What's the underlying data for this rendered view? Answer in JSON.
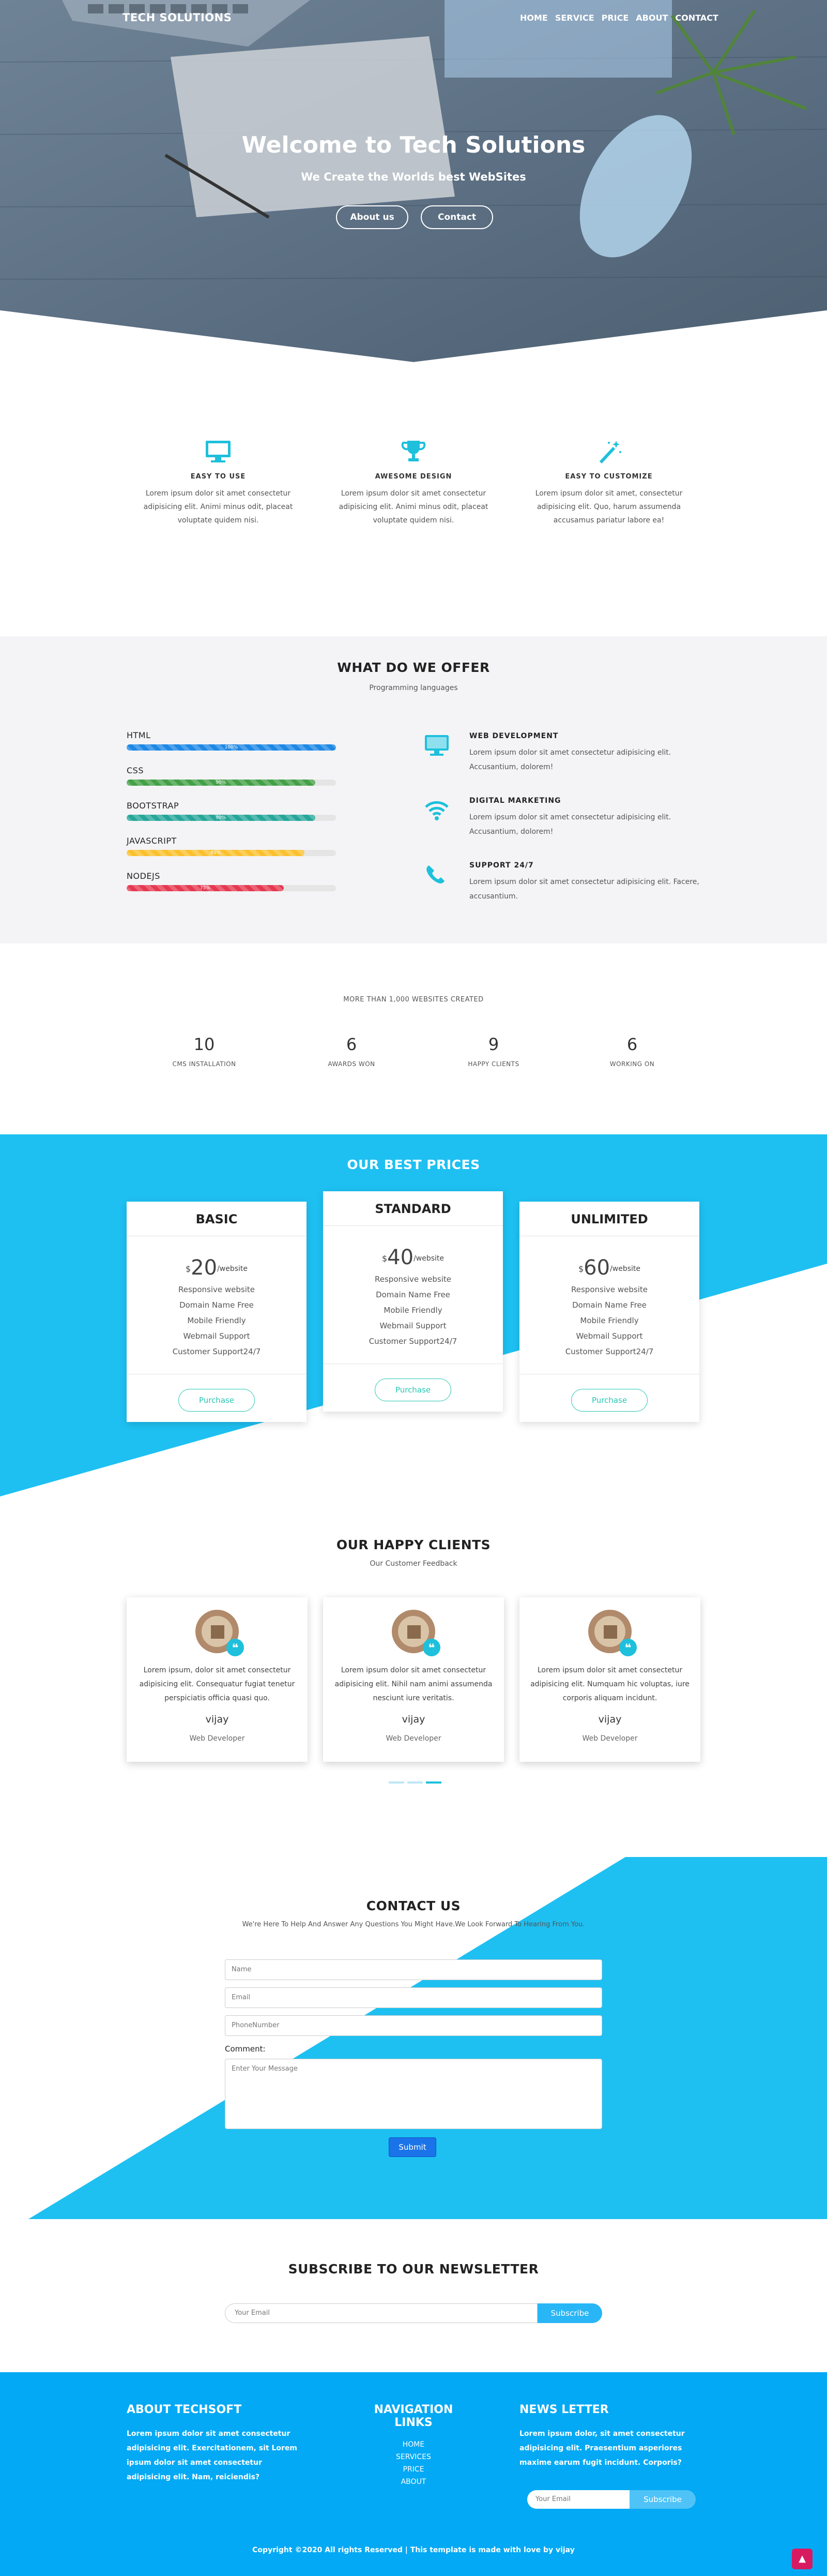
{
  "colors": {
    "accent": "#1ec0dc",
    "brand": "#03a9f4",
    "submit": "#1a73e8"
  },
  "nav": {
    "brand": "TECH SOLUTIONS",
    "links": [
      "HOME",
      "SERVICE",
      "PRICE",
      "ABOUT",
      "CONTACT"
    ]
  },
  "hero": {
    "title": "Welcome to Tech Solutions",
    "subtitle": "We Create the Worlds best WebSites",
    "btn_about": "About us",
    "btn_contact": "Contact"
  },
  "features": [
    {
      "icon": "monitor-icon",
      "title": "EASY TO USE",
      "text": "Lorem ipsum dolor sit amet consectetur adipisicing elit. Animi minus odit, placeat voluptate quidem nisi."
    },
    {
      "icon": "trophy-icon",
      "title": "AWESOME DESIGN",
      "text": "Lorem ipsum dolor sit amet consectetur adipisicing elit. Animi minus odit, placeat voluptate quidem nisi."
    },
    {
      "icon": "magic-wand-icon",
      "title": "EASY TO CUSTOMIZE",
      "text": "Lorem ipsum dolor sit amet, consectetur adipisicing elit. Quo, harum assumenda accusamus pariatur labore ea!"
    }
  ],
  "offer": {
    "title": "WHAT DO WE OFFER",
    "subtitle": "Programming languages",
    "skills": [
      {
        "name": "HTML",
        "percent": 100,
        "label": "100%",
        "color": "#1e88e5"
      },
      {
        "name": "CSS",
        "percent": 90,
        "label": "90%",
        "color": "#43a047"
      },
      {
        "name": "BOOTSTRAP",
        "percent": 90,
        "label": "90%",
        "color": "#26a69a"
      },
      {
        "name": "JAVASCRIPT",
        "percent": 85,
        "label": "85%",
        "color": "#fbc02d"
      },
      {
        "name": "NODEJS",
        "percent": 75,
        "label": "75%",
        "color": "#e53950"
      }
    ],
    "services": [
      {
        "icon": "desktop-icon",
        "title": "WEB DEVELOPMENT",
        "text": "Lorem ipsum dolor sit amet consectetur adipisicing elit. Accusantium, dolorem!"
      },
      {
        "icon": "wifi-icon",
        "title": "DIGITAL MARKETING",
        "text": "Lorem ipsum dolor sit amet consectetur adipisicing elit. Accusantium, dolorem!"
      },
      {
        "icon": "phone-icon",
        "title": "SUPPORT 24/7",
        "text": "Lorem ipsum dolor sit amet consectetur adipisicing elit. Facere, accusantium."
      }
    ]
  },
  "stats": {
    "caption": "MORE THAN 1,000 WEBSITES CREATED",
    "items": [
      {
        "num": "10",
        "label": "CMS INSTALLATION"
      },
      {
        "num": "6",
        "label": "AWARDS WON"
      },
      {
        "num": "9",
        "label": "HAPPY CLIENTS"
      },
      {
        "num": "6",
        "label": "WORKING ON"
      }
    ]
  },
  "pricing": {
    "title": "OUR BEST PRICES",
    "plans": [
      {
        "name": "BASIC",
        "currency": "$",
        "amount": "20",
        "period": "/website",
        "features": [
          "Responsive website",
          "Domain Name Free",
          "Mobile Friendly",
          "Webmail Support",
          "Customer Support24/7"
        ],
        "button": "Purchase"
      },
      {
        "name": "STANDARD",
        "currency": "$",
        "amount": "40",
        "period": "/website",
        "features": [
          "Responsive website",
          "Domain Name Free",
          "Mobile Friendly",
          "Webmail Support",
          "Customer Support24/7"
        ],
        "button": "Purchase"
      },
      {
        "name": "UNLIMITED",
        "currency": "$",
        "amount": "60",
        "period": "/website",
        "features": [
          "Responsive website",
          "Domain Name Free",
          "Mobile Friendly",
          "Webmail Support",
          "Customer Support24/7"
        ],
        "button": "Purchase"
      }
    ]
  },
  "clients": {
    "title": "OUR HAPPY CLIENTS",
    "subtitle": "Our Customer Feedback",
    "items": [
      {
        "text": "Lorem ipsum, dolor sit amet consectetur adipisicing elit. Consequatur fugiat tenetur perspiciatis officia quasi quo.",
        "name": "vijay",
        "role": "Web Developer"
      },
      {
        "text": "Lorem ipsum dolor sit amet consectetur adipisicing elit. Nihil nam animi assumenda nesciunt iure veritatis.",
        "name": "vijay",
        "role": "Web Developer"
      },
      {
        "text": "Lorem ipsum dolor sit amet consectetur adipisicing elit. Numquam hic voluptas, iure corporis aliquam incidunt.",
        "name": "vijay",
        "role": "Web Developer"
      }
    ]
  },
  "contact": {
    "title": "CONTACT US",
    "subtitle": "We're Here To Help And Answer Any Questions You Might Have.We Look Forward To Hearing From You.",
    "name_placeholder": "Name",
    "email_placeholder": "Email",
    "phone_placeholder": "PhoneNumber",
    "comment_label": "Comment:",
    "message_placeholder": "Enter Your Message",
    "submit": "Submit"
  },
  "newsletter": {
    "title": "SUBSCRIBE TO OUR NEWSLETTER",
    "placeholder": "Your Email",
    "button": "Subscribe"
  },
  "footer": {
    "about_title": "ABOUT TECHSOFT",
    "about_text": "Lorem ipsum dolor sit amet consectetur adipisicing elit. Exercitationem, sit Lorem ipsum dolor sit amet consectetur adipisicing elit. Nam, reiciendis?",
    "nav_title": "NAVIGATION LINKS",
    "nav_links": [
      "HOME",
      "SERVICES",
      "PRICE",
      "ABOUT"
    ],
    "news_title": "NEWS LETTER",
    "news_text": "Lorem ipsum dolor, sit amet consectetur adipisicing elit. Praesentium asperiores maxime earum fugit incidunt. Corporis?",
    "news_placeholder": "Your Email",
    "news_button": "Subscribe",
    "copyright": "Copyright ©2020 All rights Reserved | This template is made with love by vijay"
  }
}
